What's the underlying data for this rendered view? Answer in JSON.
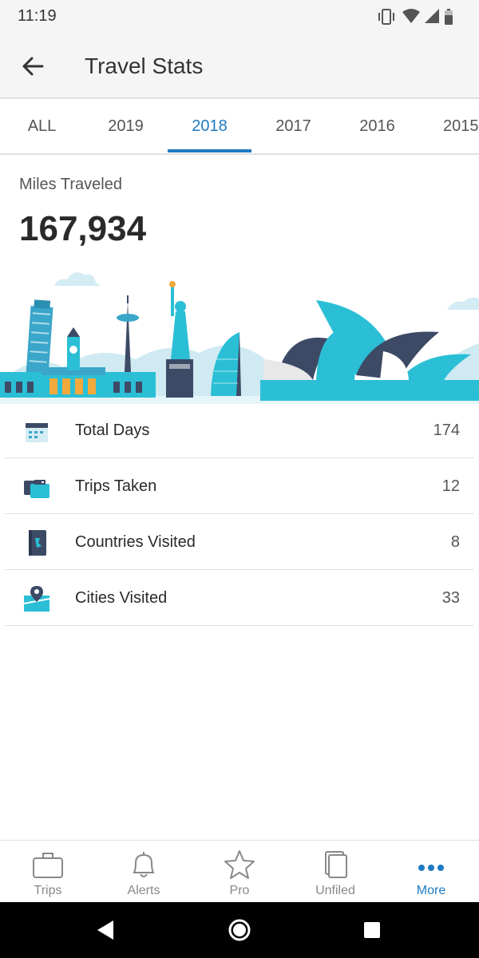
{
  "status_bar": {
    "time": "11:19",
    "icons": [
      "vibrate-icon",
      "wifi-icon",
      "signal-icon",
      "battery-icon"
    ]
  },
  "app_bar": {
    "title": "Travel Stats",
    "back_icon": "arrow-left-icon"
  },
  "tabs": [
    {
      "label": "ALL",
      "active": false
    },
    {
      "label": "2019",
      "active": false
    },
    {
      "label": "2018",
      "active": true
    },
    {
      "label": "2017",
      "active": false
    },
    {
      "label": "2016",
      "active": false
    },
    {
      "label": "2015",
      "active": false
    }
  ],
  "miles": {
    "label": "Miles Traveled",
    "value": "167,934"
  },
  "stats": [
    {
      "icon": "calendar-icon",
      "label": "Total Days",
      "value": "174"
    },
    {
      "icon": "luggage-icon",
      "label": "Trips Taken",
      "value": "12"
    },
    {
      "icon": "passport-icon",
      "label": "Countries Visited",
      "value": "8"
    },
    {
      "icon": "map-pin-icon",
      "label": "Cities Visited",
      "value": "33"
    }
  ],
  "bottom_nav": [
    {
      "icon": "briefcase-icon",
      "label": "Trips",
      "active": false
    },
    {
      "icon": "bell-icon",
      "label": "Alerts",
      "active": false
    },
    {
      "icon": "star-icon",
      "label": "Pro",
      "active": false
    },
    {
      "icon": "documents-icon",
      "label": "Unfiled",
      "active": false
    },
    {
      "icon": "more-dots-icon",
      "label": "More",
      "active": true
    }
  ],
  "colors": {
    "accent": "#1e7bc2",
    "teal": "#2bbfd6",
    "navy": "#3d4a66"
  }
}
